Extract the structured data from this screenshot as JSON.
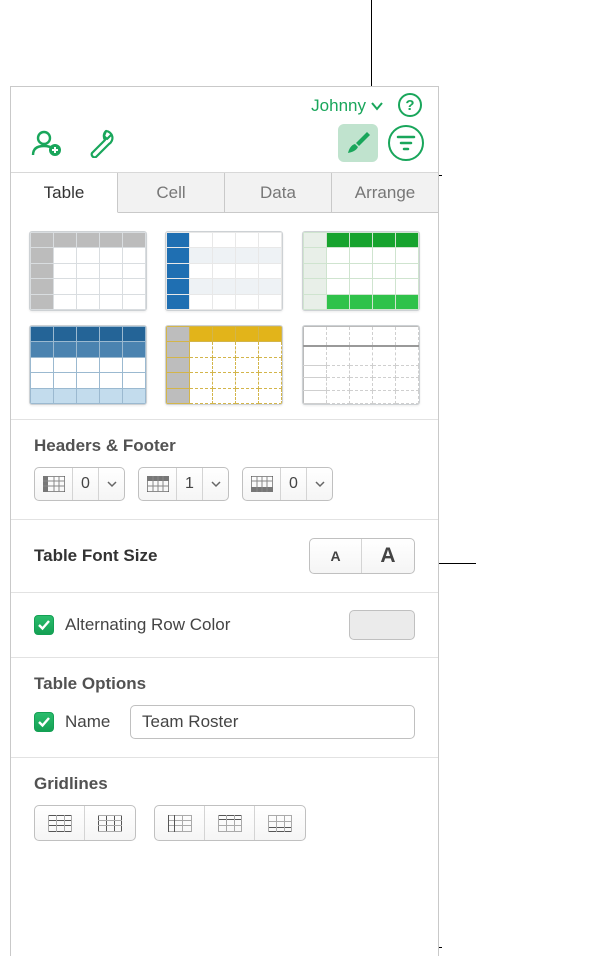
{
  "header": {
    "user_name": "Johnny",
    "help_glyph": "?"
  },
  "tabs": [
    "Table",
    "Cell",
    "Data",
    "Arrange"
  ],
  "tabs_active_index": 0,
  "headers_footer": {
    "title": "Headers & Footer",
    "header_cols": "0",
    "header_rows": "1",
    "footer_rows": "0"
  },
  "font_size": {
    "title": "Table Font Size",
    "small_glyph": "A",
    "big_glyph": "A"
  },
  "alt_row": {
    "label": "Alternating Row Color",
    "checked": true
  },
  "options": {
    "title": "Table Options",
    "name_label": "Name",
    "name_checked": true,
    "name_value": "Team Roster"
  },
  "gridlines": {
    "title": "Gridlines"
  }
}
